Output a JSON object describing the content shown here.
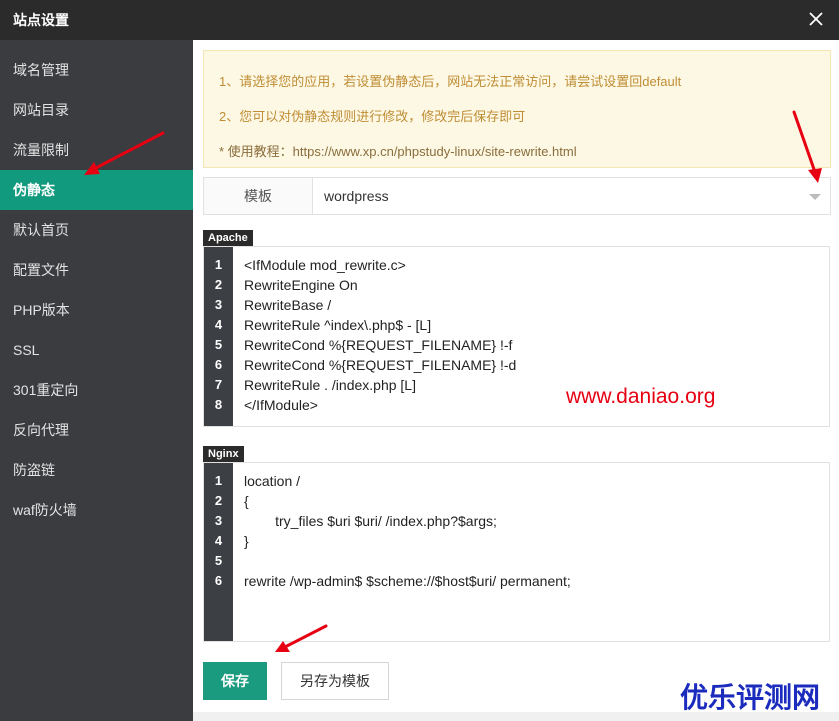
{
  "dialog": {
    "title": "站点设置"
  },
  "sidebar": {
    "items": [
      {
        "label": "域名管理",
        "active": false
      },
      {
        "label": "网站目录",
        "active": false
      },
      {
        "label": "流量限制",
        "active": false
      },
      {
        "label": "伪静态",
        "active": true
      },
      {
        "label": "默认首页",
        "active": false
      },
      {
        "label": "配置文件",
        "active": false
      },
      {
        "label": "PHP版本",
        "active": false
      },
      {
        "label": "SSL",
        "active": false
      },
      {
        "label": "301重定向",
        "active": false
      },
      {
        "label": "反向代理",
        "active": false
      },
      {
        "label": "防盗链",
        "active": false
      },
      {
        "label": "waf防火墙",
        "active": false
      }
    ]
  },
  "notice": {
    "line1": "1、请选择您的应用，若设置伪静态后，网站无法正常访问，请尝试设置回default",
    "line2": "2、您可以对伪静态规则进行修改，修改完后保存即可",
    "line3": "* 使用教程：https://www.xp.cn/phpstudy-linux/site-rewrite.html"
  },
  "template": {
    "label": "模板",
    "value": "wordpress"
  },
  "apache": {
    "tag": "Apache",
    "lines": [
      "<IfModule mod_rewrite.c>",
      "RewriteEngine On",
      "RewriteBase /",
      "RewriteRule ^index\\.php$ - [L]",
      "RewriteCond %{REQUEST_FILENAME} !-f",
      "RewriteCond %{REQUEST_FILENAME} !-d",
      "RewriteRule . /index.php [L]",
      "</IfModule>"
    ]
  },
  "nginx": {
    "tag": "Nginx",
    "lines": [
      "location /",
      "{",
      "        try_files $uri $uri/ /index.php?$args;",
      "}",
      "",
      "rewrite /wp-admin$ $scheme://$host$uri/ permanent;"
    ]
  },
  "buttons": {
    "save": "保存",
    "save_as_template": "另存为模板"
  },
  "watermarks": {
    "site": "www.daniao.org",
    "brand": "优乐评测网"
  },
  "colors": {
    "accent": "#129a7e",
    "annotation_arrow": "#e60012"
  }
}
